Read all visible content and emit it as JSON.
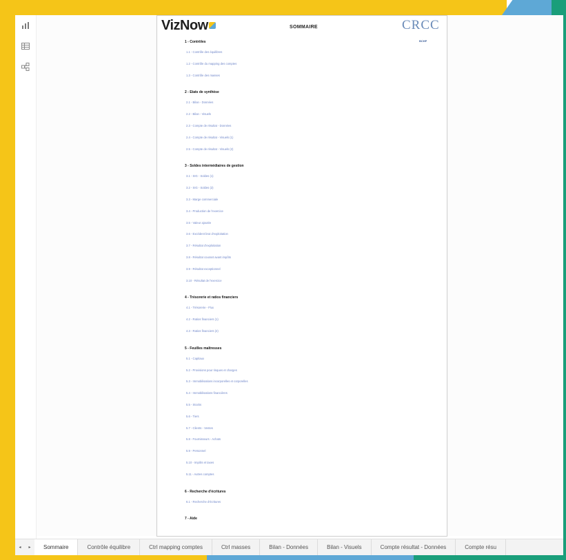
{
  "rail": {
    "icons": [
      "report-icon",
      "table-icon",
      "model-icon"
    ]
  },
  "report": {
    "logo": "VizNow",
    "title": "SOMMAIRE",
    "crcc": "CRCC",
    "crcc_sub": "BCHP"
  },
  "toc": [
    {
      "section": "1 - Contrôles",
      "items": [
        "1.1 - Contrôle des équilibres",
        "1.2 - Contrôle du mapping des comptes",
        "1.3 - Contrôle des masses"
      ]
    },
    {
      "section": "2 - Etats de synthèse",
      "items": [
        "2.1 - Bilan - Données",
        "2.2 - Bilan - Visuels",
        "2.3 - Compte de résultat - Données",
        "2.4 - Compte de résultat - Visuels (1)",
        "2.5 - Compte de résultat - Visuels (2)"
      ]
    },
    {
      "section": "3 - Soldes intermédiaires de gestion",
      "items": [
        "3.1 - SIG - Soldes (1)",
        "3.2 - SIG - Soldes (2)",
        "3.3 - Marge commerciale",
        "3.4 - Production de l'exercice",
        "3.5 - Valeur ajoutée",
        "3.6 - Excédent brut d'exploitation",
        "3.7 - Résultat d'exploitation",
        "3.8 - Résultat courant avant impôts",
        "3.9 - Résultat exceptionnel",
        "3.10 - Résultat de l'exercice"
      ]
    },
    {
      "section": "4 - Trésorerie et ratios financiers",
      "items": [
        "4.1 - Trésorerie - Flux",
        "4.2 - Ratios financiers (1)",
        "4.3 - Ratios financiers (2)"
      ]
    },
    {
      "section": "5 - Feuilles maîtresses",
      "items": [
        "5.1 - Capitaux",
        "5.2 - Provisions pour risques et charges",
        "5.3 - Immobilisations incorporelles et corporelles",
        "5.4 - Immobilisations financières",
        "5.5 - Stocks",
        "5.6 - Tiers",
        "5.7 - Clients - Ventes",
        "5.8 - Fournisseurs - Achats",
        "5.9 - Personnel",
        "5.10 - Impôts et taxes",
        "5.11 - Autres comptes"
      ]
    },
    {
      "section": "6 - Recherche d'écritures",
      "items": [
        "6.1 - Recherche d'écritures"
      ]
    },
    {
      "section": "7 - Aide",
      "items": []
    }
  ],
  "tabs": {
    "prev": "◂",
    "next": "▸",
    "items": [
      "Sommaire",
      "Contrôle équilibre",
      "Ctrl mapping comptes",
      "Ctrl masses",
      "Bilan - Données",
      "Bilan - Visuels",
      "Compte résultat - Données",
      "Compte résu"
    ]
  },
  "colors": {
    "yellow": "#f5c518",
    "blue": "#5ea8d6",
    "green": "#1a9e7a",
    "link": "#6f86c9"
  }
}
